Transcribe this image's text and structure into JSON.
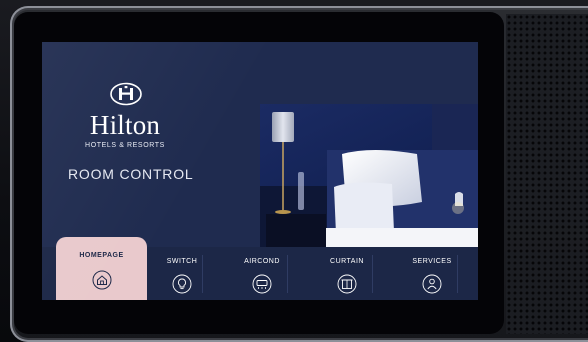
{
  "brand": {
    "name": "Hilton",
    "tagline": "HOTELS & RESORTS",
    "logo_icon": "hilton-h-logo"
  },
  "screen_title": "ROOM CONTROL",
  "nav": {
    "items": [
      {
        "label": "HOMEPAGE",
        "icon": "home-icon",
        "active": true
      },
      {
        "label": "SWITCH",
        "icon": "lightbulb-icon",
        "active": false
      },
      {
        "label": "AIRCOND",
        "icon": "air-conditioner-icon",
        "active": false
      },
      {
        "label": "CURTAIN",
        "icon": "curtain-icon",
        "active": false
      },
      {
        "label": "SERVICES",
        "icon": "person-service-icon",
        "active": false
      }
    ]
  },
  "colors": {
    "screen_background": "#1f2b4f",
    "nav_background": "#1c2747",
    "active_tab": "#e9c9cc",
    "text": "#ffffff"
  }
}
